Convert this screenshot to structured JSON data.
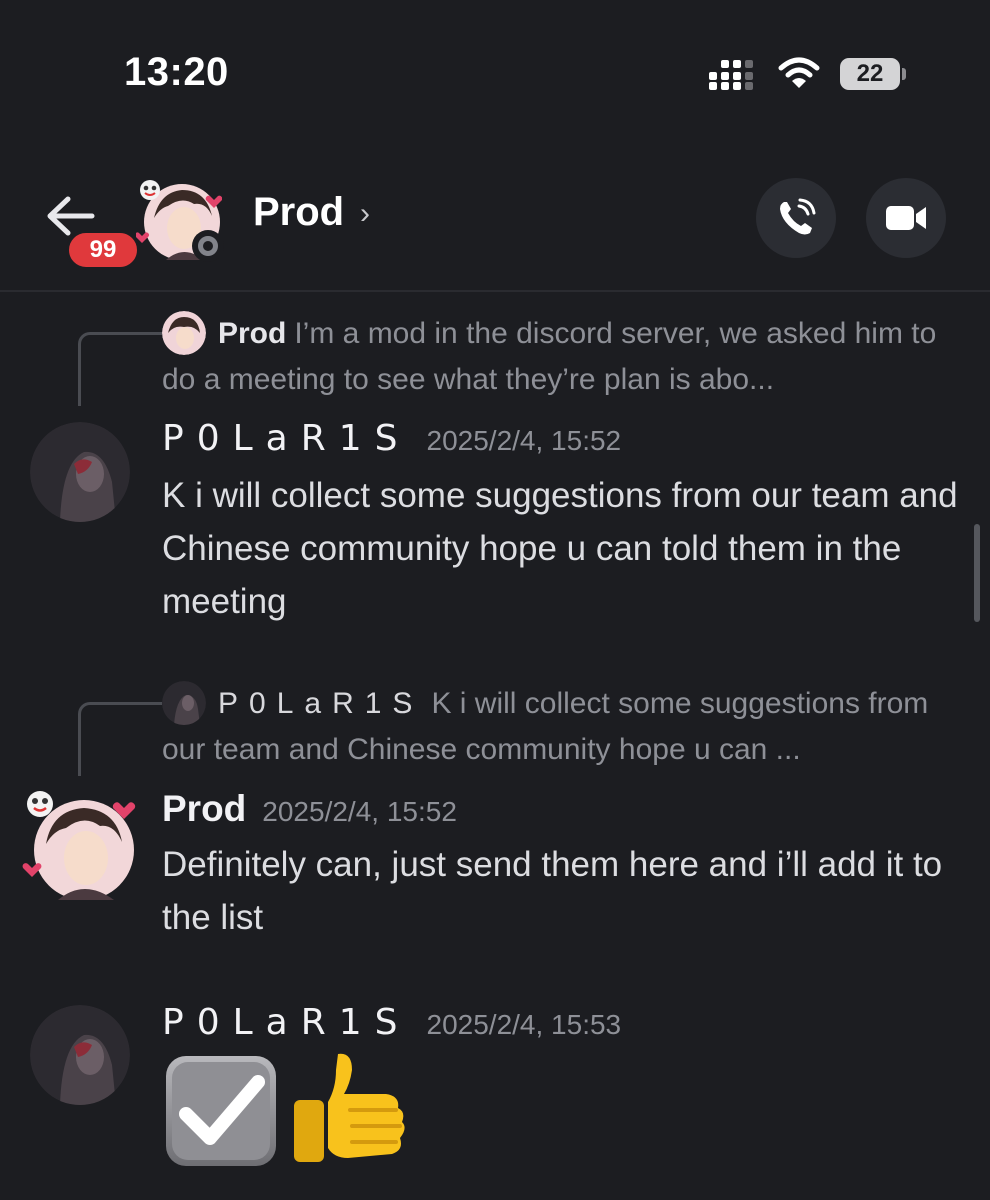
{
  "status_bar": {
    "time": "13:20",
    "battery": "22"
  },
  "header": {
    "unread_count": "99",
    "title": "Prod",
    "chevron": "›"
  },
  "messages": [
    {
      "reply": {
        "author": "Prod",
        "text": "I’m a mod in the discord server, we asked him to do a meeting to see what they’re plan is abo..."
      },
      "author": "P0LaR1S",
      "timestamp": "2025/2/4, 15:52",
      "text": "K i will collect some suggestions from our team and Chinese community hope u can told them in the meeting"
    },
    {
      "reply": {
        "author": "P0LaR1S",
        "text": "K i will collect some suggestions from our team and Chinese community hope u can ..."
      },
      "author": "Prod",
      "timestamp": "2025/2/4, 15:52",
      "text": "Definitely can, just send them here and i’ll add it to the list"
    },
    {
      "author": "P0LaR1S",
      "timestamp": "2025/2/4, 15:53",
      "emojis": [
        "check-mark-button-emoji",
        "thumbs-up-emoji"
      ]
    }
  ],
  "colors": {
    "background": "#1c1d21",
    "badge": "#e0393c",
    "muted_text": "#8e9097",
    "button_bg": "#2b2d33"
  }
}
